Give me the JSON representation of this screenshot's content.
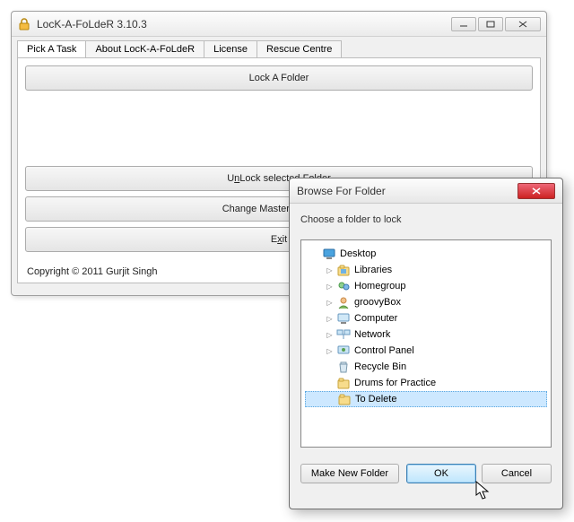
{
  "main": {
    "title": "LocK-A-FoLdeR 3.10.3",
    "tabs": [
      {
        "label": "Pick A Task",
        "active": true
      },
      {
        "label": "About LocK-A-FoLdeR",
        "active": false
      },
      {
        "label": "License",
        "active": false
      },
      {
        "label": "Rescue Centre",
        "active": false
      }
    ],
    "buttons": {
      "lock": "Lock A Folder",
      "unlock_pre": "U",
      "unlock_u": "n",
      "unlock_post": "Lock selected Folder",
      "change": "Change Master Password",
      "exit_pre": "E",
      "exit_u": "x",
      "exit_post": "it"
    },
    "copyright": "Copyright © 2011 Gurjit Singh"
  },
  "dialog": {
    "title": "Browse For Folder",
    "instruction": "Choose a folder to lock",
    "tree": [
      {
        "label": "Desktop",
        "depth": 0,
        "expander": "",
        "icon": "desktop"
      },
      {
        "label": "Libraries",
        "depth": 1,
        "expander": "▷",
        "icon": "libraries"
      },
      {
        "label": "Homegroup",
        "depth": 1,
        "expander": "▷",
        "icon": "homegroup"
      },
      {
        "label": "groovyBox",
        "depth": 1,
        "expander": "▷",
        "icon": "user"
      },
      {
        "label": "Computer",
        "depth": 1,
        "expander": "▷",
        "icon": "computer"
      },
      {
        "label": "Network",
        "depth": 1,
        "expander": "▷",
        "icon": "network"
      },
      {
        "label": "Control Panel",
        "depth": 1,
        "expander": "▷",
        "icon": "controlpanel"
      },
      {
        "label": "Recycle Bin",
        "depth": 1,
        "expander": "",
        "icon": "recycle"
      },
      {
        "label": "Drums for Practice",
        "depth": 1,
        "expander": "",
        "icon": "folder"
      },
      {
        "label": "To Delete",
        "depth": 1,
        "expander": "",
        "icon": "folder",
        "selected": true
      }
    ],
    "buttons": {
      "make": "Make New Folder",
      "ok": "OK",
      "cancel": "Cancel"
    }
  }
}
